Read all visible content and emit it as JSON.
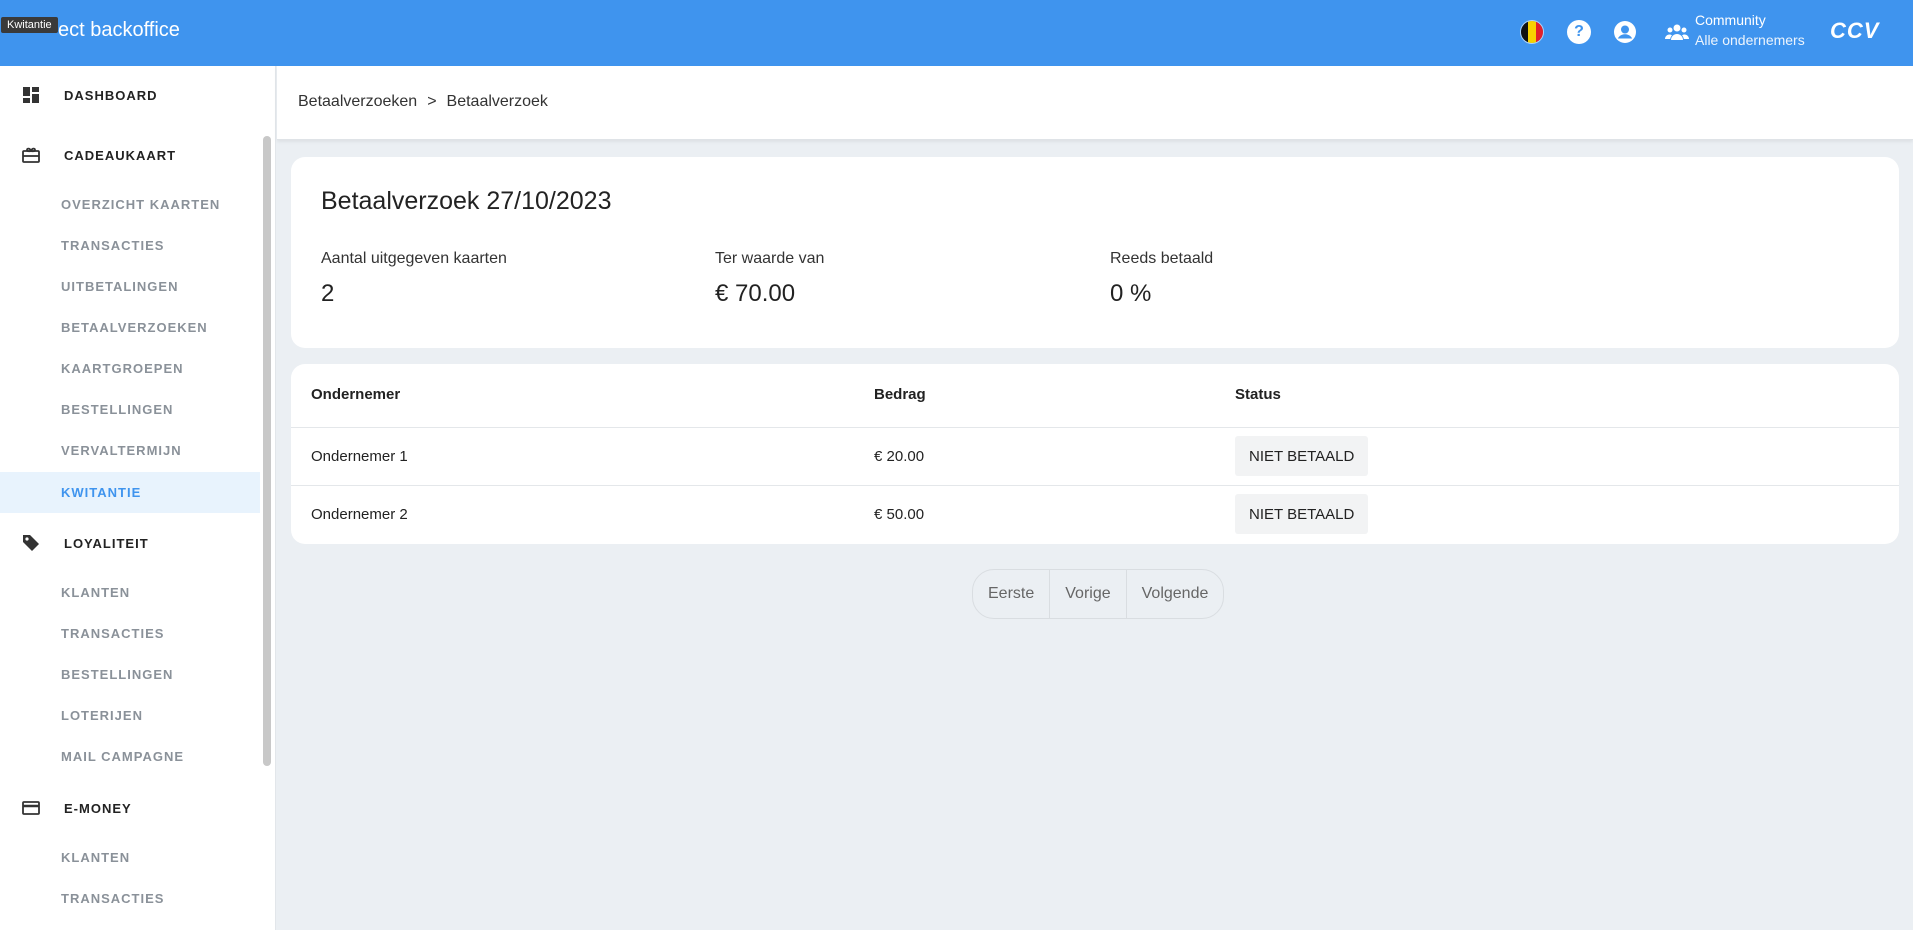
{
  "header": {
    "app_title": "ect backoffice",
    "tooltip": "Kwitantie",
    "community_label": "Community",
    "community_sub": "Alle ondernemers",
    "logo_text": "CCV",
    "brand_color": "#3f94ee"
  },
  "sidebar": {
    "sections": [
      {
        "label": "DASHBOARD",
        "icon": "dashboard-icon"
      },
      {
        "label": "CADEAUKAART",
        "icon": "gift-card-icon"
      },
      {
        "label": "LOYALITEIT",
        "icon": "tag-icon"
      },
      {
        "label": "E-MONEY",
        "icon": "credit-card-icon"
      }
    ],
    "cadeaukaart_items": [
      "OVERZICHT KAARTEN",
      "TRANSACTIES",
      "UITBETALINGEN",
      "BETAALVERZOEKEN",
      "KAARTGROEPEN",
      "BESTELLINGEN",
      "VERVALTERMIJN",
      "KWITANTIE"
    ],
    "loyaliteit_items": [
      "KLANTEN",
      "TRANSACTIES",
      "BESTELLINGEN",
      "LOTERIJEN",
      "MAIL CAMPAGNE"
    ],
    "emoney_items": [
      "KLANTEN",
      "TRANSACTIES"
    ],
    "active_item": "KWITANTIE"
  },
  "breadcrumb": {
    "parent": "Betaalverzoeken",
    "separator": ">",
    "current": "Betaalverzoek"
  },
  "summary": {
    "title": "Betaalverzoek 27/10/2023",
    "stats": [
      {
        "label": "Aantal uitgegeven kaarten",
        "value": "2"
      },
      {
        "label": "Ter waarde van",
        "value": "€ 70.00"
      },
      {
        "label": "Reeds betaald",
        "value": "0 %"
      }
    ]
  },
  "table": {
    "columns": [
      "Ondernemer",
      "Bedrag",
      "Status"
    ],
    "rows": [
      {
        "ondernemer": "Ondernemer 1",
        "bedrag": "€ 20.00",
        "status": "NIET BETAALD"
      },
      {
        "ondernemer": "Ondernemer 2",
        "bedrag": "€ 50.00",
        "status": "NIET BETAALD"
      }
    ]
  },
  "pager": {
    "first": "Eerste",
    "prev": "Vorige",
    "next": "Volgende"
  }
}
